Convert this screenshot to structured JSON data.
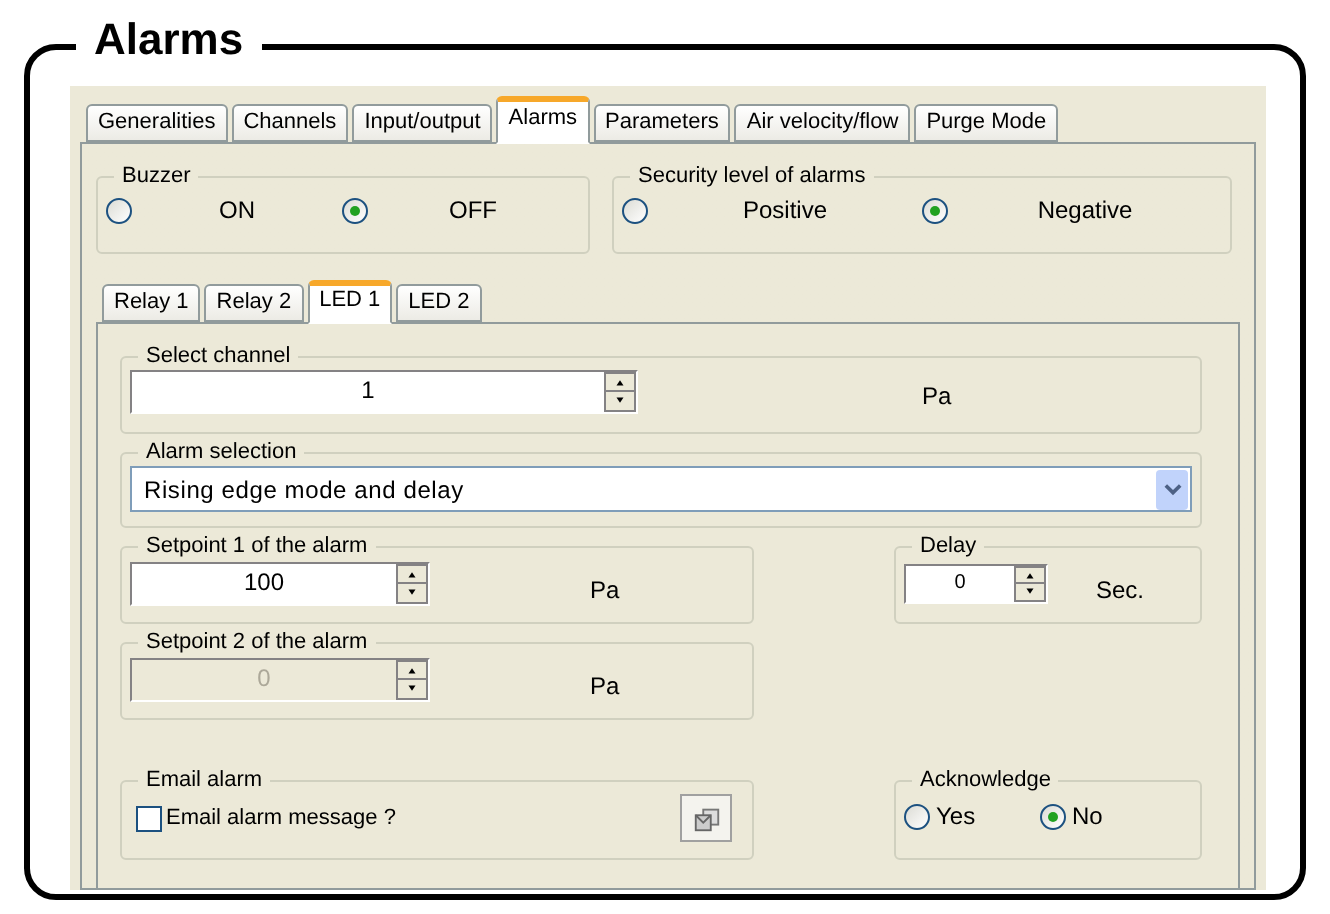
{
  "title": "Alarms",
  "tabs": [
    {
      "label": "Generalities",
      "selected": false
    },
    {
      "label": "Channels",
      "selected": false
    },
    {
      "label": "Input/output",
      "selected": false
    },
    {
      "label": "Alarms",
      "selected": true
    },
    {
      "label": "Parameters",
      "selected": false
    },
    {
      "label": "Air velocity/flow",
      "selected": false
    },
    {
      "label": "Purge Mode",
      "selected": false
    }
  ],
  "buzzer": {
    "legend": "Buzzer",
    "options": [
      {
        "label": "ON",
        "selected": false
      },
      {
        "label": "OFF",
        "selected": true
      }
    ]
  },
  "security": {
    "legend": "Security level of alarms",
    "options": [
      {
        "label": "Positive",
        "selected": false
      },
      {
        "label": "Negative",
        "selected": true
      }
    ]
  },
  "sub_tabs": [
    {
      "label": "Relay 1",
      "selected": false
    },
    {
      "label": "Relay 2",
      "selected": false
    },
    {
      "label": "LED 1",
      "selected": true
    },
    {
      "label": "LED 2",
      "selected": false
    }
  ],
  "select_channel": {
    "legend": "Select channel",
    "value": "1",
    "unit": "Pa"
  },
  "alarm_selection": {
    "legend": "Alarm selection",
    "value": "Rising edge mode and delay"
  },
  "setpoint_1": {
    "legend": "Setpoint 1 of the alarm",
    "value": "100",
    "unit": "Pa",
    "disabled": false
  },
  "delay": {
    "legend": "Delay",
    "value": "0",
    "unit": "Sec."
  },
  "setpoint_2": {
    "legend": "Setpoint 2 of the alarm",
    "value": "0",
    "unit": "Pa",
    "disabled": true
  },
  "email_alarm": {
    "legend": "Email alarm",
    "checkbox": {
      "label": "Email alarm message ?",
      "checked": false
    }
  },
  "acknowledge": {
    "legend": "Acknowledge",
    "options": [
      {
        "label": "Yes",
        "selected": false
      },
      {
        "label": "No",
        "selected": true
      }
    ]
  }
}
